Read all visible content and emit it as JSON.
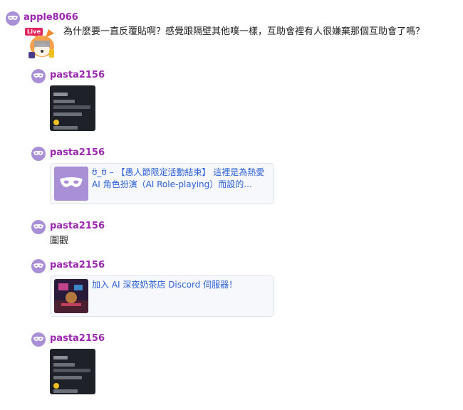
{
  "thread": {
    "root": {
      "username": "apple8066",
      "live_badge": "Live",
      "text": "為什麼要一直反覆貼啊？感覺跟隔壁其他噗一樣，互助會裡有人很嫌棄那個互助會了嗎？"
    },
    "replies": [
      {
        "username": "pasta2156",
        "type": "image"
      },
      {
        "username": "pasta2156",
        "type": "link",
        "link_text": "ʊ̈_ʊ̈ – 【愚人節限定活動結束】 這裡是為熱愛 AI 角色扮演（AI Role-playing）而設的..."
      },
      {
        "username": "pasta2156",
        "type": "text",
        "text": "圍觀"
      },
      {
        "username": "pasta2156",
        "type": "link",
        "link_text": "加入 AI 深夜奶茶店 Discord 伺服器！"
      },
      {
        "username": "pasta2156",
        "type": "image"
      }
    ]
  },
  "colors": {
    "username": "#9b27b0",
    "avatar_bg": "#a88fd6",
    "link_text": "#2c5fd6",
    "live_badge": "#e0245e",
    "card_bg": "#f6f8fb"
  },
  "icons": {
    "avatar": "mask-icon",
    "link_thumb_1": "mask-icon",
    "link_thumb_2": "neon-cafe-image",
    "root_avatar": "fox-character-image"
  }
}
